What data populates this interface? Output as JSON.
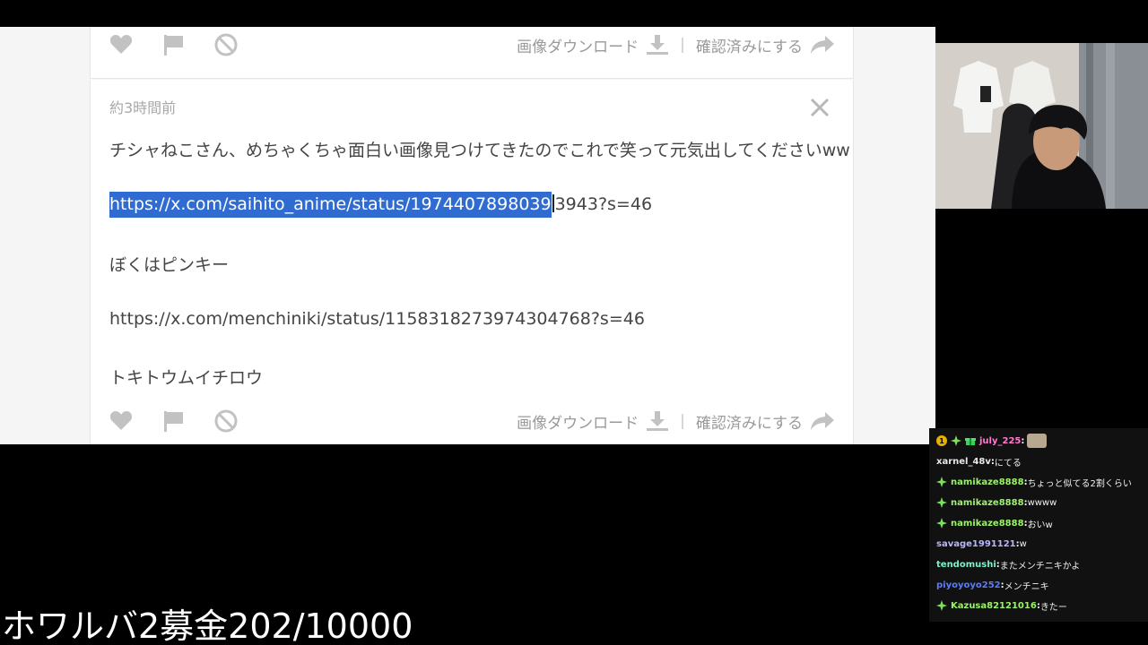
{
  "browser": {
    "top_card": {
      "download_label": "画像ダウンロード",
      "separator": "|",
      "confirm_label": "確認済みにする"
    },
    "message": {
      "timestamp": "約3時間前",
      "line1": "チシャねこさん、めちゃくちゃ面白い画像見つけてきたのでこれで笑って元気出してくださいww",
      "link1_selected": "https://x.com/saihito_anime/status/1974407898039",
      "link1_rest": "3943?s=46",
      "line3": "ぼくはピンキー",
      "link2": "https://x.com/menchiniki/status/1158318273974304768?s=46",
      "line5": "トキトウムイチロウ",
      "download_label": "画像ダウンロード",
      "separator": "|",
      "confirm_label": "確認済みにする"
    }
  },
  "chat": {
    "messages": [
      {
        "user": "july_225",
        "text": "",
        "user_color": "#ff7ad0",
        "badges": [
          "gold-1",
          "green-sparkle",
          "gift"
        ],
        "emote": true
      },
      {
        "user": "xarnel_48v",
        "text": "にてる",
        "user_color": "#e8e8e8",
        "badges": []
      },
      {
        "user": "namikaze8888",
        "text": "ちょっと似てる2割くらい",
        "user_color": "#9cf26a",
        "badges": [
          "green-sparkle"
        ]
      },
      {
        "user": "namikaze8888",
        "text": "wwww",
        "user_color": "#9cf26a",
        "badges": [
          "green-sparkle"
        ]
      },
      {
        "user": "namikaze8888",
        "text": "おいw",
        "user_color": "#9cf26a",
        "badges": [
          "green-sparkle"
        ]
      },
      {
        "user": "savage1991121",
        "text": "w",
        "user_color": "#b6b6ff",
        "badges": []
      },
      {
        "user": "tendomushi",
        "text": "またメンチニキかよ",
        "user_color": "#7ff0c8",
        "badges": []
      },
      {
        "user": "piyoyoyo252",
        "text": "メンチニキ",
        "user_color": "#5a7dff",
        "badges": []
      },
      {
        "user": "Kazusa82121016",
        "text": "きたー",
        "user_color": "#9cf26a",
        "badges": [
          "green-sparkle"
        ]
      }
    ],
    "colon": ": "
  },
  "overlay": {
    "donation_text": "ホワルバ2募金202/10000"
  },
  "colors": {
    "selection": "#2f6bd1",
    "icon_gray": "#c2c2c2",
    "text_gray": "#444444"
  },
  "icons": [
    "heart-icon",
    "flag-icon",
    "ban-icon",
    "download-icon",
    "share-arrow-icon",
    "close-icon"
  ]
}
